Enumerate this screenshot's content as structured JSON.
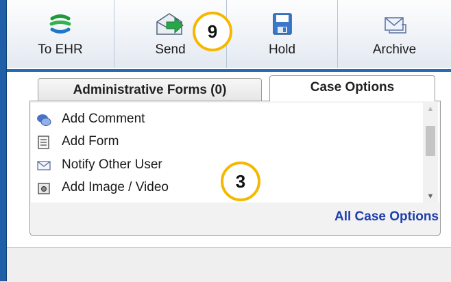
{
  "toolbar": {
    "buttons": [
      {
        "label": "To EHR",
        "icon": "ehr-globe-icon"
      },
      {
        "label": "Send",
        "icon": "send-envelope-icon"
      },
      {
        "label": "Hold",
        "icon": "floppy-disk-icon"
      },
      {
        "label": "Archive",
        "icon": "archive-envelope-icon"
      }
    ]
  },
  "tabs": [
    {
      "label": "Administrative Forms (0)",
      "active": false
    },
    {
      "label": "Case Options",
      "active": true
    }
  ],
  "case_options": {
    "items": [
      {
        "label": "Add Comment",
        "icon": "comment-bubbles-icon"
      },
      {
        "label": "Add Form",
        "icon": "form-icon"
      },
      {
        "label": "Notify Other User",
        "icon": "envelope-icon"
      },
      {
        "label": "Add Image / Video",
        "icon": "camera-icon"
      }
    ],
    "all_link": "All Case Options"
  },
  "callouts": [
    {
      "number": "9"
    },
    {
      "number": "3"
    }
  ],
  "colors": {
    "frame_blue": "#1f5fa8",
    "link_blue": "#1f3fae",
    "callout_ring": "#f5b800"
  }
}
